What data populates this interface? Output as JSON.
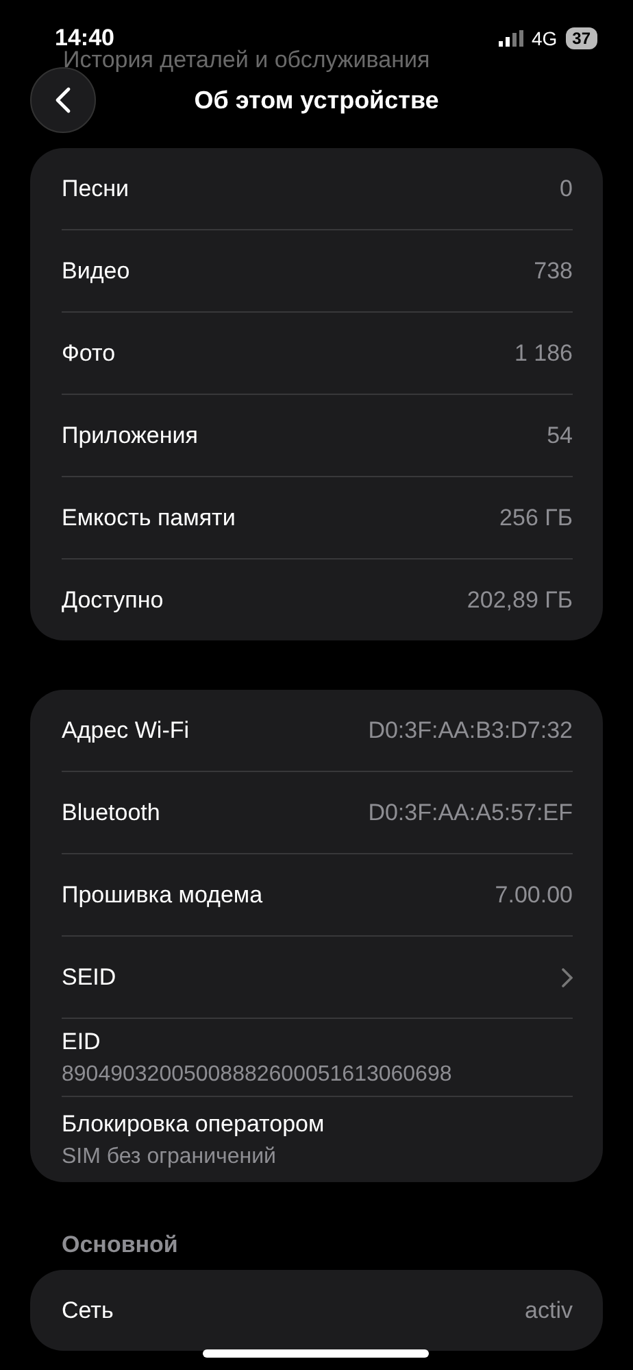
{
  "status_bar": {
    "time": "14:40",
    "network": "4G",
    "battery": "37"
  },
  "behind_text": "История деталей и обслуживания",
  "header": {
    "title": "Об этом устройстве"
  },
  "groups": [
    {
      "rows": [
        {
          "kind": "value",
          "label": "Песни",
          "value": "0"
        },
        {
          "kind": "value",
          "label": "Видео",
          "value": "738"
        },
        {
          "kind": "value",
          "label": "Фото",
          "value": "1 186"
        },
        {
          "kind": "value",
          "label": "Приложения",
          "value": "54"
        },
        {
          "kind": "value",
          "label": "Емкость памяти",
          "value": "256 ГБ"
        },
        {
          "kind": "value",
          "label": "Доступно",
          "value": "202,89 ГБ"
        }
      ]
    },
    {
      "rows": [
        {
          "kind": "value",
          "label": "Адрес Wi-Fi",
          "value": "D0:3F:AA:B3:D7:32"
        },
        {
          "kind": "value",
          "label": "Bluetooth",
          "value": "D0:3F:AA:A5:57:EF"
        },
        {
          "kind": "value",
          "label": "Прошивка модема",
          "value": "7.00.00"
        },
        {
          "kind": "link",
          "label": "SEID"
        },
        {
          "kind": "stacked",
          "label": "EID",
          "value": "89049032005008882600051613060698"
        },
        {
          "kind": "stacked",
          "label": "Блокировка оператором",
          "value": "SIM без ограничений"
        }
      ]
    },
    {
      "title": "Основной",
      "rows": [
        {
          "kind": "value",
          "label": "Сеть",
          "value": "activ"
        }
      ]
    }
  ]
}
